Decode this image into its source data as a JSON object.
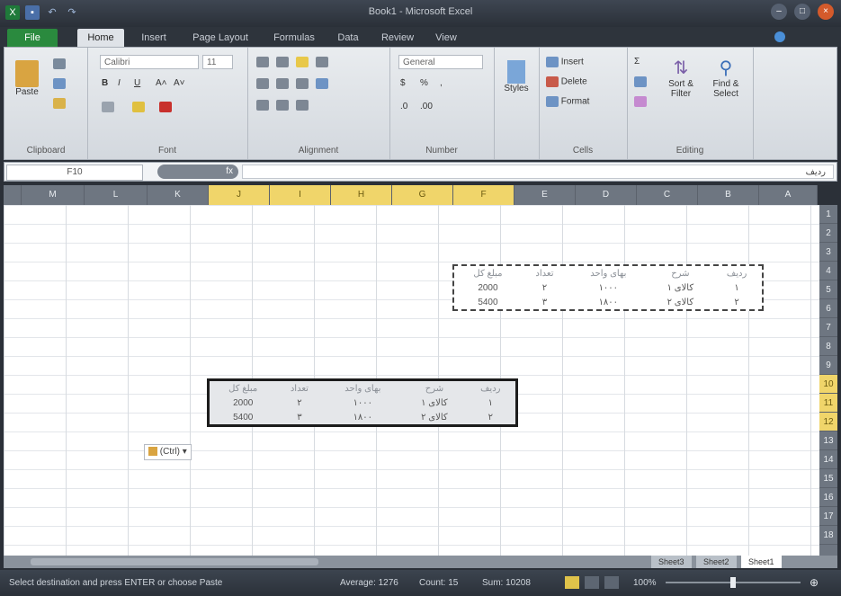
{
  "window": {
    "title": "Book1 - Microsoft Excel"
  },
  "ribbon": {
    "tabs": [
      "File",
      "Home",
      "Insert",
      "Page Layout",
      "Formulas",
      "Data",
      "Review",
      "View"
    ],
    "clipboard": {
      "label": "Clipboard",
      "paste": "Paste"
    },
    "font": {
      "label": "Font",
      "name": "Calibri",
      "size": "11"
    },
    "alignment": {
      "label": "Alignment"
    },
    "number": {
      "label": "Number",
      "format": "General"
    },
    "styles": {
      "label": "Styles"
    },
    "cells": {
      "label": "Cells",
      "insert": "Insert",
      "delete": "Delete",
      "format": "Format"
    },
    "editing": {
      "label": "Editing",
      "sort": "Sort & Filter",
      "find": "Find & Select"
    }
  },
  "formula_bar": {
    "name_box": "F10",
    "fx": "fx",
    "content": "ردیف"
  },
  "columns": [
    "M",
    "L",
    "K",
    "J",
    "I",
    "H",
    "G",
    "F",
    "E",
    "D",
    "C",
    "B",
    "A"
  ],
  "rows": [
    "1",
    "2",
    "3",
    "4",
    "5",
    "6",
    "7",
    "8",
    "9",
    "10",
    "11",
    "12",
    "13",
    "14",
    "15",
    "16",
    "17",
    "18"
  ],
  "table_source": {
    "headers": [
      "ردیف",
      "شرح",
      "بهای واحد",
      "تعداد",
      "مبلغ کل"
    ],
    "rows": [
      [
        "۱",
        "کالای ۱",
        "۱۰۰۰",
        "۲",
        "2000"
      ],
      [
        "۲",
        "کالای ۲",
        "۱۸۰۰",
        "۳",
        "5400"
      ]
    ]
  },
  "table_pasted": {
    "headers": [
      "ردیف",
      "شرح",
      "بهای واحد",
      "تعداد",
      "مبلغ کل"
    ],
    "rows": [
      [
        "۱",
        "کالای ۱",
        "۱۰۰۰",
        "۲",
        "2000"
      ],
      [
        "۲",
        "کالای ۲",
        "۱۸۰۰",
        "۳",
        "5400"
      ]
    ]
  },
  "paste_options": {
    "label": "(Ctrl)"
  },
  "sheets": [
    "Sheet3",
    "Sheet2",
    "Sheet1"
  ],
  "status": {
    "message": "Select destination and press ENTER or choose Paste",
    "average": "Average: 1276",
    "count": "Count: 15",
    "sum": "Sum: 10208",
    "zoom": "100%"
  },
  "colors": {
    "selection": "#f0d56a",
    "file_tab": "#2a8a3e",
    "accent": "#1f7a3a"
  }
}
